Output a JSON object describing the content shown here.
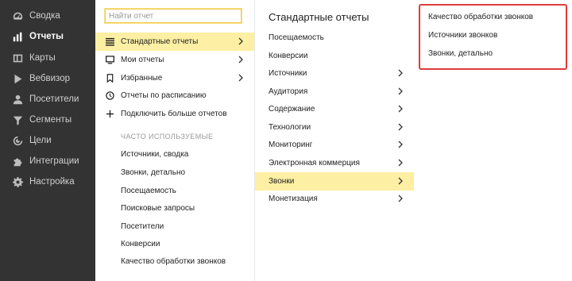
{
  "sidebar": {
    "items": [
      {
        "label": "Сводка",
        "icon": "gauge-icon",
        "active": false
      },
      {
        "label": "Отчеты",
        "icon": "bar-chart-icon",
        "active": true
      },
      {
        "label": "Карты",
        "icon": "map-icon",
        "active": false
      },
      {
        "label": "Вебвизор",
        "icon": "play-icon",
        "active": false
      },
      {
        "label": "Посетители",
        "icon": "user-icon",
        "active": false
      },
      {
        "label": "Сегменты",
        "icon": "filter-icon",
        "active": false
      },
      {
        "label": "Цели",
        "icon": "target-icon",
        "active": false
      },
      {
        "label": "Интеграции",
        "icon": "puzzle-icon",
        "active": false
      },
      {
        "label": "Настройка",
        "icon": "gear-icon",
        "active": false
      }
    ]
  },
  "menu": {
    "search_placeholder": "Найти отчет",
    "items": [
      {
        "label": "Стандартные отчеты",
        "icon": "list-icon"
      },
      {
        "label": "Мои отчеты",
        "icon": "monitor-icon"
      },
      {
        "label": "Избранные",
        "icon": "bookmark-icon"
      },
      {
        "label": "Отчеты по расписанию",
        "icon": "clock-icon"
      },
      {
        "label": "Подключить больше отчетов",
        "icon": "plus-icon"
      }
    ],
    "frequent_label": "ЧАСТО ИСПОЛЬЗУЕМЫЕ",
    "frequent": [
      "Источники, сводка",
      "Звонки, детально",
      "Посещаемость",
      "Поисковые запросы",
      "Посетители",
      "Конверсии",
      "Качество обработки звонков"
    ]
  },
  "standard": {
    "title": "Стандартные отчеты",
    "items": [
      "Посещаемость",
      "Конверсии",
      "Источники",
      "Аудитория",
      "Содержание",
      "Технологии",
      "Мониторинг",
      "Электронная коммерция",
      "Звонки",
      "Монетизация"
    ]
  },
  "calls": {
    "items": [
      "Качество обработки звонков",
      "Источники звонков",
      "Звонки, детально"
    ]
  },
  "colors": {
    "sidebar_bg": "#333333",
    "selected_bg": "#fdefa3",
    "highlight_border": "#e03a3a",
    "search_border": "#f2c94c"
  }
}
